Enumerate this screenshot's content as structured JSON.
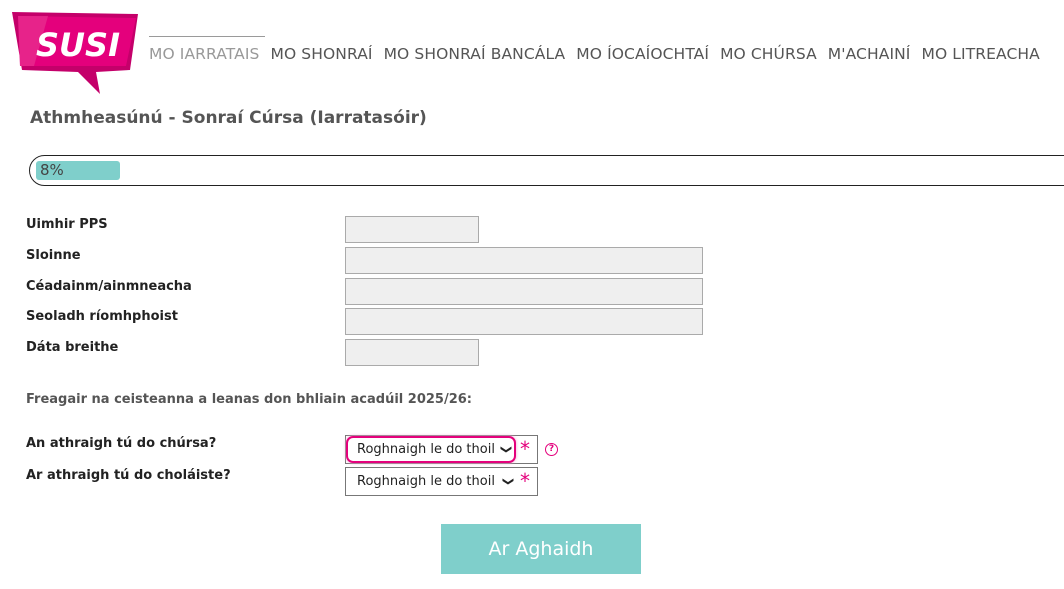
{
  "brand": {
    "logo_text": "SUSI",
    "pink": "#e4007c",
    "teal": "#7fcfcb"
  },
  "nav": {
    "items": [
      {
        "label": "MO IARRATAIS",
        "active": true
      },
      {
        "label": "MO SHONRAÍ"
      },
      {
        "label": "MO SHONRAÍ BANCÁLA"
      },
      {
        "label": "MO ÍOCAÍOCHTAÍ"
      },
      {
        "label": "MO CHÚRSA"
      },
      {
        "label": "M'ACHAINÍ"
      },
      {
        "label": "MO LITREACHA"
      }
    ]
  },
  "page": {
    "title": "Athmheasúnú - Sonraí Cúrsa (Iarratasóir)"
  },
  "progress": {
    "label": "8%",
    "percent": 8
  },
  "form": {
    "pps_label": "Uimhir PPS",
    "pps_value": "",
    "surname_label": "Sloinne",
    "surname_value": "",
    "firstname_label": "Céadainm/ainmneacha",
    "firstname_value": "",
    "email_label": "Seoladh ríomhphoist",
    "email_value": "",
    "dob_label": "Dáta breithe",
    "dob_value": ""
  },
  "questions": {
    "intro": "Freagair na ceisteanna a leanas don bhliain acadúil 2025/26:",
    "course_change_label": "An athraigh tú do chúrsa?",
    "course_change_selected": "Roghnaigh le do thoil",
    "college_change_label": "Ar athraigh tú do choláiste?",
    "college_change_selected": "Roghnaigh le do thoil",
    "required_mark": "*",
    "help_mark": "?"
  },
  "actions": {
    "next_label": "Ar Aghaidh"
  }
}
